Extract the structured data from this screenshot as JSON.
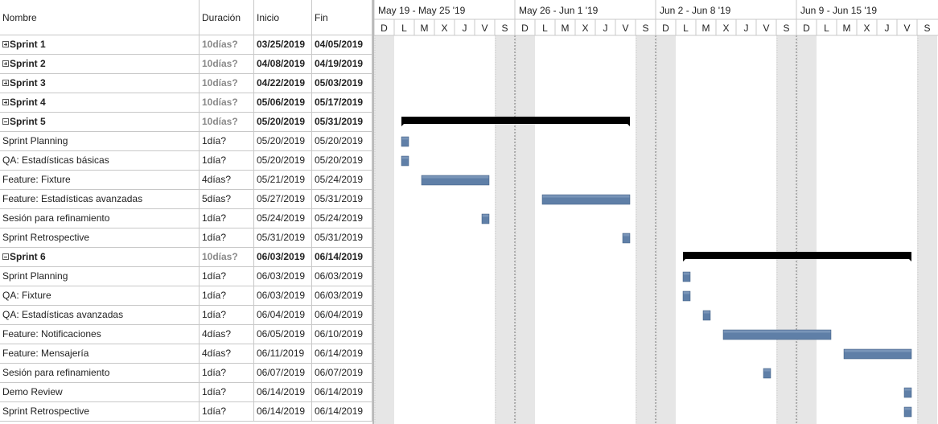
{
  "table": {
    "headers": {
      "name": "Nombre",
      "duration": "Duración",
      "start": "Inicio",
      "end": "Fin"
    },
    "rows": [
      {
        "kind": "group",
        "expander": "plus",
        "name": "Sprint 1",
        "duration": "10días?",
        "start": "03/25/2019",
        "end": "04/05/2019"
      },
      {
        "kind": "group",
        "expander": "plus",
        "name": "Sprint 2",
        "duration": "10días?",
        "start": "04/08/2019",
        "end": "04/19/2019"
      },
      {
        "kind": "group",
        "expander": "plus",
        "name": "Sprint 3",
        "duration": "10días?",
        "start": "04/22/2019",
        "end": "05/03/2019"
      },
      {
        "kind": "group",
        "expander": "plus",
        "name": "Sprint 4",
        "duration": "10días?",
        "start": "05/06/2019",
        "end": "05/17/2019"
      },
      {
        "kind": "group",
        "expander": "minus",
        "name": "Sprint 5",
        "duration": "10días?",
        "start": "05/20/2019",
        "end": "05/31/2019"
      },
      {
        "kind": "task",
        "name": "Sprint Planning",
        "duration": "1día?",
        "start": "05/20/2019",
        "end": "05/20/2019"
      },
      {
        "kind": "task",
        "name": "QA: Estadísticas básicas",
        "duration": "1día?",
        "start": "05/20/2019",
        "end": "05/20/2019"
      },
      {
        "kind": "task",
        "name": "Feature: Fixture",
        "duration": "4días?",
        "start": "05/21/2019",
        "end": "05/24/2019"
      },
      {
        "kind": "task",
        "name": "Feature: Estadísticas avanzadas",
        "duration": "5días?",
        "start": "05/27/2019",
        "end": "05/31/2019"
      },
      {
        "kind": "task",
        "name": "Sesión para refinamiento",
        "duration": "1día?",
        "start": "05/24/2019",
        "end": "05/24/2019"
      },
      {
        "kind": "task",
        "name": "Sprint Retrospective",
        "duration": "1día?",
        "start": "05/31/2019",
        "end": "05/31/2019"
      },
      {
        "kind": "group",
        "expander": "minus",
        "name": "Sprint 6",
        "duration": "10días?",
        "start": "06/03/2019",
        "end": "06/14/2019"
      },
      {
        "kind": "task",
        "name": "Sprint Planning",
        "duration": "1día?",
        "start": "06/03/2019",
        "end": "06/03/2019"
      },
      {
        "kind": "task",
        "name": "QA: Fixture",
        "duration": "1día?",
        "start": "06/03/2019",
        "end": "06/03/2019"
      },
      {
        "kind": "task",
        "name": "QA: Estadísticas avanzadas",
        "duration": "1día?",
        "start": "06/04/2019",
        "end": "06/04/2019"
      },
      {
        "kind": "task",
        "name": "Feature: Notificaciones",
        "duration": "4días?",
        "start": "06/05/2019",
        "end": "06/10/2019"
      },
      {
        "kind": "task",
        "name": "Feature: Mensajería",
        "duration": "4días?",
        "start": "06/11/2019",
        "end": "06/14/2019"
      },
      {
        "kind": "task",
        "name": "Sesión para refinamiento",
        "duration": "1día?",
        "start": "06/07/2019",
        "end": "06/07/2019"
      },
      {
        "kind": "task",
        "name": "Demo Review",
        "duration": "1día?",
        "start": "06/14/2019",
        "end": "06/14/2019"
      },
      {
        "kind": "task",
        "name": "Sprint Retrospective",
        "duration": "1día?",
        "start": "06/14/2019",
        "end": "06/14/2019"
      }
    ]
  },
  "timeline": {
    "first_day": "2019-05-19",
    "weeks": [
      "May 19 - May 25 '19",
      "May 26 - Jun 1 '19",
      "Jun 2 - Jun 8 '19",
      "Jun 9 - Jun 15 '19"
    ],
    "day_letters": [
      "D",
      "L",
      "M",
      "X",
      "J",
      "V",
      "S"
    ]
  },
  "colors": {
    "task_bar": "#5f7fa7",
    "task_bar_top": "#8aa3c3",
    "summary_bar": "#000000",
    "weekend_shade": "#e6e6e6",
    "grid_line": "#c8c8c8"
  }
}
